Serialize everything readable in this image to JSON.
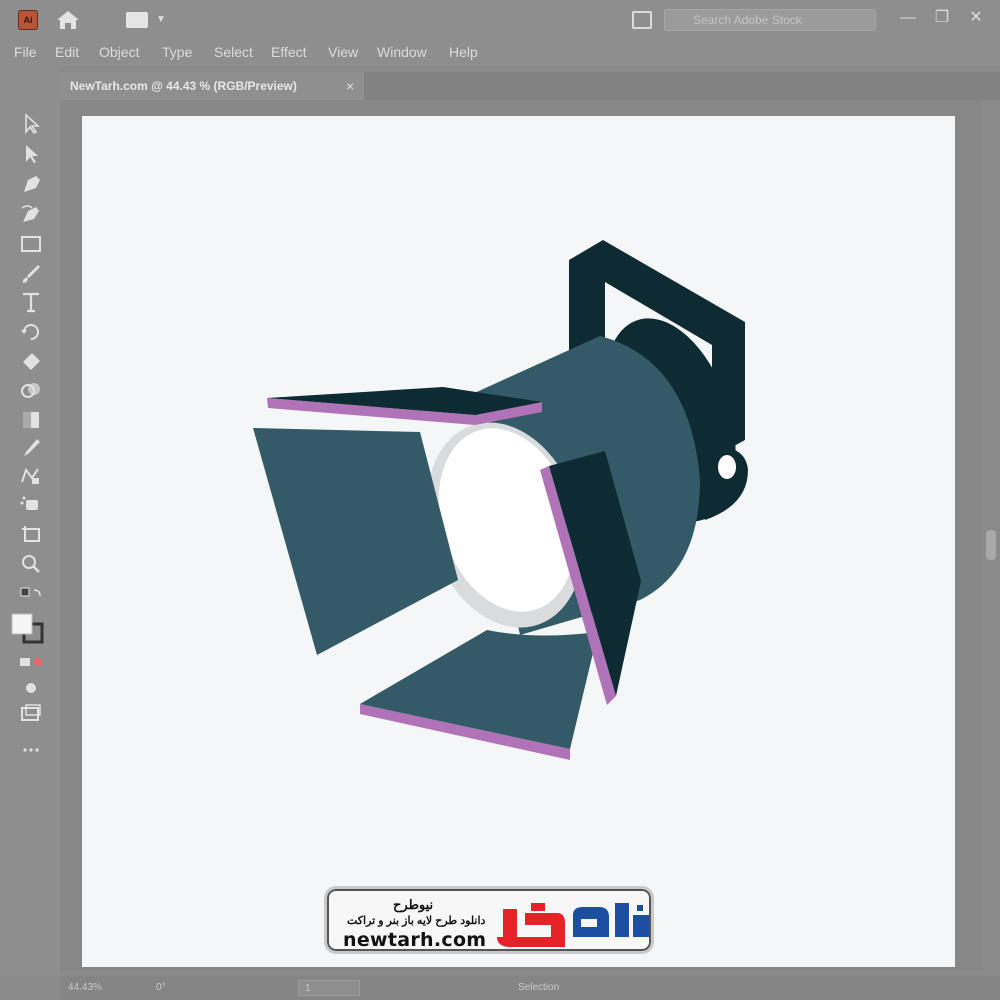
{
  "window": {
    "app_icon_text": "Ai",
    "search_placeholder": "Search Adobe Stock",
    "minimize": "—",
    "maximize": "❐",
    "close": "✕"
  },
  "menu": {
    "items": [
      "File",
      "Edit",
      "Object",
      "Type",
      "Select",
      "Effect",
      "View",
      "Window",
      "Help"
    ]
  },
  "document": {
    "tab_title": "NewTarh.com @ 44.43 % (RGB/Preview)",
    "tab_close": "×"
  },
  "toolbar": {
    "tools": [
      "selection-tool",
      "direct-selection-tool",
      "pen-tool",
      "curvature-tool",
      "rectangle-tool",
      "paintbrush-tool",
      "type-tool",
      "rotate-tool",
      "eraser-tool",
      "shape-builder-tool",
      "gradient-tool",
      "eyedropper-tool",
      "blend-tool",
      "symbol-sprayer-tool",
      "artboard-tool",
      "zoom-tool"
    ]
  },
  "status": {
    "zoom": "44.43%",
    "rotation": "0°",
    "artboard": "1",
    "mode": "Selection"
  },
  "watermark": {
    "title": "نیوطرح",
    "subtitle": "دانلود طرح لایه باز بنر و تراکت",
    "url": "newtarh.com"
  },
  "colors": {
    "lamp_dark": "#0e2a33",
    "lamp_body": "#335a66",
    "lamp_rim": "#d9dbdd",
    "lamp_lens": "#ffffff",
    "barndoor_edge": "#b173b8",
    "logo_red": "#e42228",
    "logo_blue": "#1d4fa1"
  }
}
